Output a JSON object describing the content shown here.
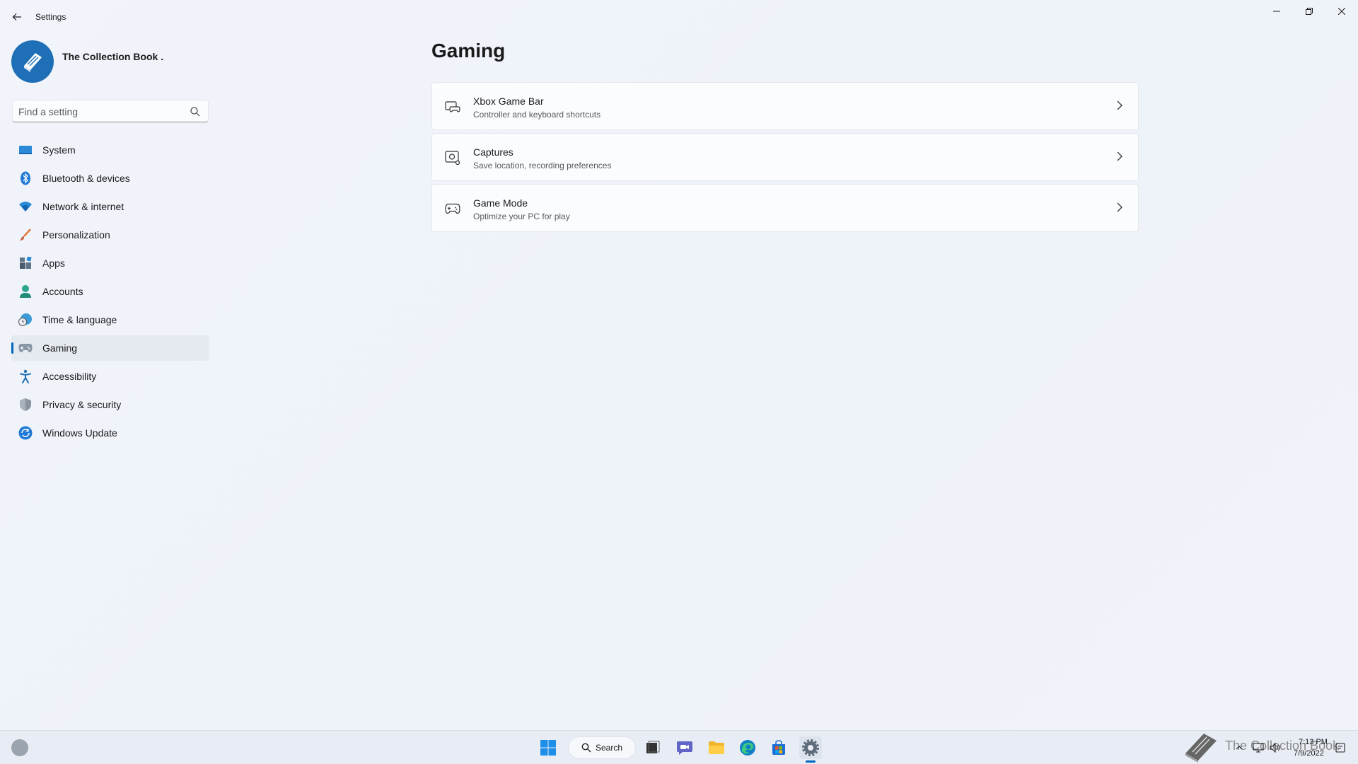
{
  "window": {
    "title": "Settings",
    "controls": {
      "minimize": "minimize-icon",
      "maximize": "restore-icon",
      "close": "close-icon"
    }
  },
  "profile": {
    "name": "The Collection Book ."
  },
  "search": {
    "placeholder": "Find a setting",
    "value": ""
  },
  "sidebar": {
    "items": [
      {
        "label": "System",
        "icon": "system-icon"
      },
      {
        "label": "Bluetooth & devices",
        "icon": "bluetooth-icon"
      },
      {
        "label": "Network & internet",
        "icon": "wifi-icon"
      },
      {
        "label": "Personalization",
        "icon": "brush-icon"
      },
      {
        "label": "Apps",
        "icon": "apps-icon"
      },
      {
        "label": "Accounts",
        "icon": "person-icon"
      },
      {
        "label": "Time & language",
        "icon": "globe-clock-icon"
      },
      {
        "label": "Gaming",
        "icon": "gamepad-icon",
        "active": true
      },
      {
        "label": "Accessibility",
        "icon": "accessibility-icon"
      },
      {
        "label": "Privacy & security",
        "icon": "shield-icon"
      },
      {
        "label": "Windows Update",
        "icon": "update-icon"
      }
    ]
  },
  "main": {
    "title": "Gaming",
    "cards": [
      {
        "title": "Xbox Game Bar",
        "description": "Controller and keyboard shortcuts",
        "icon": "game-bar-icon"
      },
      {
        "title": "Captures",
        "description": "Save location, recording preferences",
        "icon": "capture-icon"
      },
      {
        "title": "Game Mode",
        "description": "Optimize your PC for play",
        "icon": "controller-icon"
      }
    ]
  },
  "taskbar": {
    "search_label": "Search",
    "apps": [
      "start-icon",
      "task-view-icon",
      "chat-icon",
      "file-explorer-icon",
      "edge-icon",
      "store-icon",
      "settings-icon"
    ],
    "watermark_text": "The Collection Book",
    "clock": {
      "time": "7:13 PM",
      "date": "7/9/2022"
    }
  },
  "colors": {
    "accent": "#0067c0",
    "background": "#eef2f8"
  }
}
